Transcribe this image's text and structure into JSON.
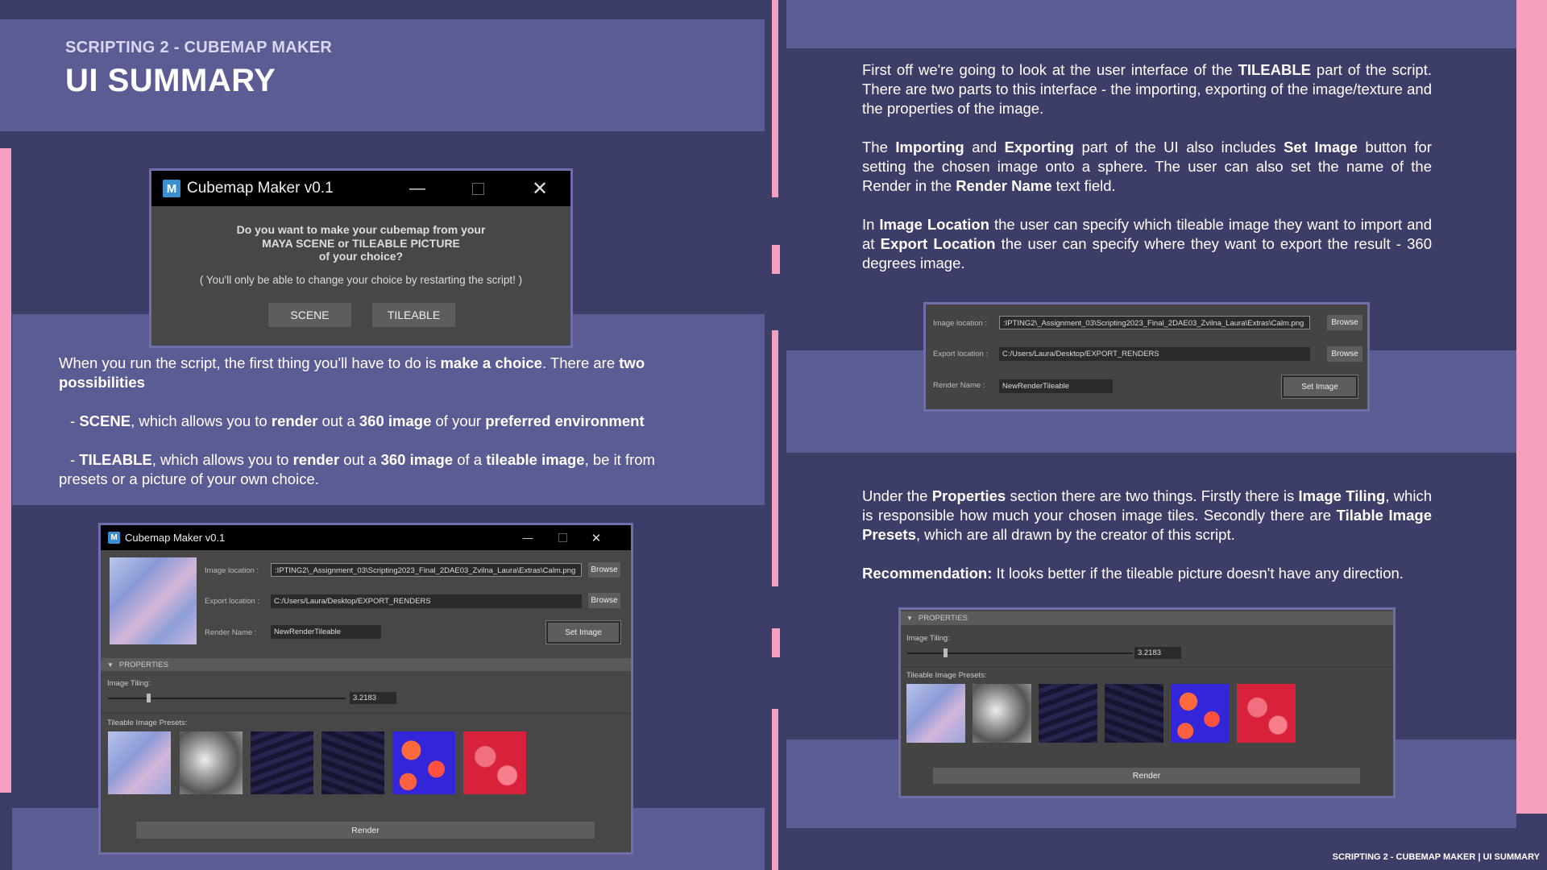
{
  "slide": {
    "subtitle": "SCRIPTING 2 - CUBEMAP MAKER",
    "title": "UI SUMMARY",
    "footer": "SCRIPTING 2 - CUBEMAP MAKER | UI SUMMARY"
  },
  "choice_window": {
    "title": "Cubemap Maker v0.1",
    "question_line1": "Do you want to make your cubemap from your",
    "question_line2": "MAYA SCENE or TILEABLE PICTURE",
    "question_line3": "of your choice?",
    "note": "( You'll only be able to change your choice by restarting the script! )",
    "scene_button": "SCENE",
    "tileable_button": "TILEABLE"
  },
  "left_text": {
    "p1_a": "When you run the script, the first thing you'll have to do is ",
    "p1_b": "make a choice",
    "p1_c": ". There are ",
    "p1_d": "two possibilities",
    "p2_dash": "- ",
    "p2_a": "SCENE",
    "p2_b": ", which allows you to ",
    "p2_c": "render",
    "p2_d": " out a ",
    "p2_e": "360 image",
    "p2_f": " of your ",
    "p2_g": "preferred environment",
    "p3_dash": "- ",
    "p3_a": "TILEABLE",
    "p3_b": ", which allows you to ",
    "p3_c": "render",
    "p3_d": " out a ",
    "p3_e": "360 image",
    "p3_f": " of a ",
    "p3_g": "tileable image",
    "p3_h": ", be it from presets or a picture of your own choice."
  },
  "full_window": {
    "title": "Cubemap Maker v0.1",
    "image_location_label": "Image location :",
    "image_location_value": ":IPTING2\\_Assignment_03\\Scripting2023_Final_2DAE03_Zvilna_Laura\\Extras\\Calm.png",
    "export_location_label": "Export location :",
    "export_location_value": "C:/Users/Laura/Desktop/EXPORT_RENDERS",
    "render_name_label": "Render Name :",
    "render_name_value": "NewRenderTileable",
    "browse1": "Browse",
    "browse2": "Browse",
    "set_image": "Set Image",
    "properties": "PROPERTIES",
    "image_tiling_label": "Image Tiling:",
    "image_tiling_value": "3.2183",
    "presets_label": "Tileable Image Presets:",
    "render": "Render"
  },
  "right_text": {
    "p1_a": "First off we're going to look at the user interface of the ",
    "p1_b": "TILEABLE",
    "p1_c": " part of the script. There are two parts to this interface - the importing, exporting of the image/texture and the properties of the image.",
    "p2_a": "The ",
    "p2_b": "Importing",
    "p2_c": " and ",
    "p2_d": "Exporting",
    "p2_e": " part of the UI also includes ",
    "p2_f": "Set Image",
    "p2_g": " button for setting the chosen image onto a sphere. The user can also set the name of the Render in the ",
    "p2_h": "Render Name",
    "p2_i": " text field.",
    "p3_a": "In ",
    "p3_b": "Image Location",
    "p3_c": " the user can specify which tileable image they want to import and at ",
    "p3_d": "Export Location",
    "p3_e": " the user can specify where they want to export the result - 360 degrees image.",
    "p4_a": "Under the ",
    "p4_b": "Properties",
    "p4_c": " section there are two things. Firstly there is ",
    "p4_d": "Image Tiling",
    "p4_e": ", which is responsible how much your chosen image tiles. Secondly there are ",
    "p4_f": "Tilable Image Presets",
    "p4_g": ", which are all drawn by the creator of this script.",
    "p5_a": "Recommendation:",
    "p5_b": " It looks better if the tileable picture doesn't have any direction."
  },
  "io_panel": {
    "image_location_label": "Image location :",
    "image_location_value": ":IPTING2\\_Assignment_03\\Scripting2023_Final_2DAE03_Zvilna_Laura\\Extras\\Calm.png",
    "export_location_label": "Export location :",
    "export_location_value": "C:/Users/Laura/Desktop/EXPORT_RENDERS",
    "render_name_label": "Render Name :",
    "render_name_value": "NewRenderTileable",
    "browse1": "Browse",
    "browse2": "Browse",
    "set_image": "Set Image"
  },
  "props_panel": {
    "properties": "PROPERTIES",
    "image_tiling_label": "Image Tiling:",
    "image_tiling_value": "3.2183",
    "presets_label": "Tileable Image Presets:",
    "render": "Render"
  },
  "colors": {
    "background": "#3d3e67",
    "band": "#5c5c95",
    "accent_pink": "#f4a0be"
  }
}
